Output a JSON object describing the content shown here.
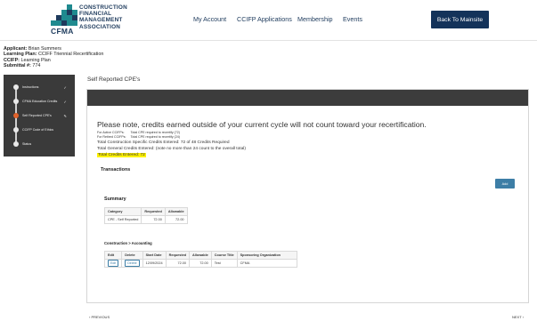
{
  "header": {
    "org_lines": [
      "CONSTRUCTION",
      "FINANCIAL",
      "MANAGEMENT",
      "ASSOCIATION"
    ],
    "org_abbr": "CFMA",
    "nav": [
      "My Account",
      "CCIFP Applications",
      "Membership",
      "Events"
    ],
    "back_button": "Back To Mainsite",
    "colors": {
      "navy": "#14335a",
      "logo_teal": "#1f8a8f",
      "logo_navy": "#1d3a5c"
    }
  },
  "applicant": {
    "name_label": "Applicant:",
    "name": "Brian Summers",
    "plan_label": "Learning Plan:",
    "plan": "CCIFF Triennial Recertification",
    "ccifp_label": "CCIFP:",
    "ccifp": "Learning Plan",
    "submittal_label": "Submittal #:",
    "submittal": "774"
  },
  "sidebar": {
    "steps": [
      {
        "label": "Instructions",
        "mark": "✓"
      },
      {
        "label": "CFMA Education Credits",
        "mark": "✓"
      },
      {
        "label": "Self Reported CPE's",
        "mark": "✎"
      },
      {
        "label": "CCIFP Code of Ethics",
        "mark": ""
      },
      {
        "label": "Status",
        "mark": ""
      }
    ],
    "active_index": 2
  },
  "page_title": "Self Reported CPE's",
  "notice": "Please note, credits earned outside of your current cycle will not count toward your recertification.",
  "requirements": {
    "active_label": "For Active CCIFPs:",
    "active_value": "Total CPE required to recertify (72)",
    "retired_label": "For Retired CCIFPs:",
    "retired_value": "Total CPE required to recertify (24)",
    "specific": "Total Construction Specific Credits Entered: 72 of 48 Credits Required",
    "general": "Total General Credits Entered: (note no more than 24 count to the overall total)",
    "total": "Total Credits Entered: 72"
  },
  "transactions": {
    "title": "Transactions",
    "add_button": "Add"
  },
  "summary": {
    "title": "Summary",
    "headers": [
      "Category",
      "Requested",
      "Allowable"
    ],
    "rows": [
      [
        "CPE - Self Reported",
        "72.00",
        "72.00"
      ]
    ]
  },
  "detail": {
    "title": "Construction > Accounting",
    "headers": [
      "Edit",
      "Delete",
      "Start Date",
      "Requested",
      "Allowable",
      "Course Title",
      "Sponsoring Organization"
    ],
    "rows": [
      {
        "edit": "Edit",
        "delete": "Delete",
        "start_date": "12/09/2024",
        "requested": "72.00",
        "allowable": "72.00",
        "course_title": "Test",
        "sponsor": "CFMA"
      }
    ]
  },
  "footer": {
    "previous": "‹ PREVIOUS",
    "next": "NEXT ›"
  }
}
